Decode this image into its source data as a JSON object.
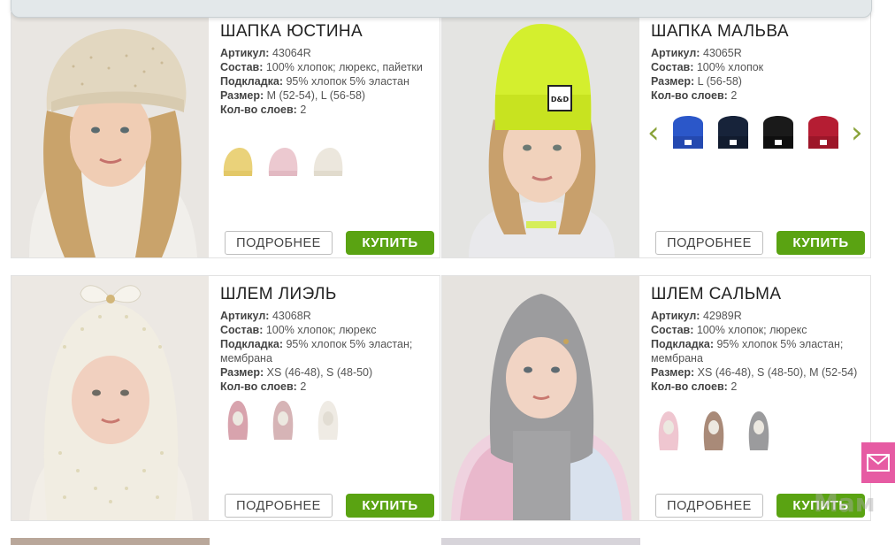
{
  "products": [
    {
      "title": "ШАПКА ЮСТИНА",
      "props": [
        {
          "label": "Артикул:",
          "value": "43064R"
        },
        {
          "label": "Состав:",
          "value": "100% хлопок; люрекс, пайетки"
        },
        {
          "label": "Подкладка:",
          "value": "95% хлопок 5% эластан"
        },
        {
          "label": "Размер:",
          "value": "M (52-54), L (56-58)"
        },
        {
          "label": "Кол-во слоев:",
          "value": "2"
        }
      ],
      "more_label": "ПОДРОБНЕЕ",
      "buy_label": "КУПИТЬ"
    },
    {
      "title": "ШАПКА МАЛЬВА",
      "props": [
        {
          "label": "Артикул:",
          "value": "43065R"
        },
        {
          "label": "Состав:",
          "value": "100% хлопок"
        },
        {
          "label": "Размер:",
          "value": "L (56-58)"
        },
        {
          "label": "Кол-во слоев:",
          "value": "2"
        }
      ],
      "more_label": "ПОДРОБНЕЕ",
      "buy_label": "КУПИТЬ"
    },
    {
      "title": "ШЛЕМ ЛИЭЛЬ",
      "props": [
        {
          "label": "Артикул:",
          "value": "43068R"
        },
        {
          "label": "Состав:",
          "value": "100% хлопок; люрекс"
        },
        {
          "label": "Подкладка:",
          "value": "95% хлопок 5% эластан; мембрана"
        },
        {
          "label": "Размер:",
          "value": "XS (46-48), S (48-50)"
        },
        {
          "label": "Кол-во слоев:",
          "value": "2"
        }
      ],
      "more_label": "ПОДРОБНЕЕ",
      "buy_label": "КУПИТЬ"
    },
    {
      "title": "ШЛЕМ САЛЬМА",
      "props": [
        {
          "label": "Артикул:",
          "value": "42989R"
        },
        {
          "label": "Состав:",
          "value": "100% хлопок; люрекс"
        },
        {
          "label": "Подкладка:",
          "value": "95% хлопок 5% эластан; мембрана"
        },
        {
          "label": "Размер:",
          "value": "XS (46-48), S (48-50), M (52-54)"
        },
        {
          "label": "Кол-во слоев:",
          "value": "2"
        }
      ],
      "more_label": "ПОДРОБНЕЕ",
      "buy_label": "КУПИТЬ"
    }
  ],
  "cap_label": "D&D",
  "watermark": "Мам",
  "icons": {
    "carousel_prev": "chevron-left-icon",
    "carousel_next": "chevron-right-icon",
    "mail": "envelope-icon"
  },
  "colors": {
    "buy_button": "#5aa312",
    "arrow": "#8aa33a",
    "mail_tab": "#e65ba3"
  }
}
